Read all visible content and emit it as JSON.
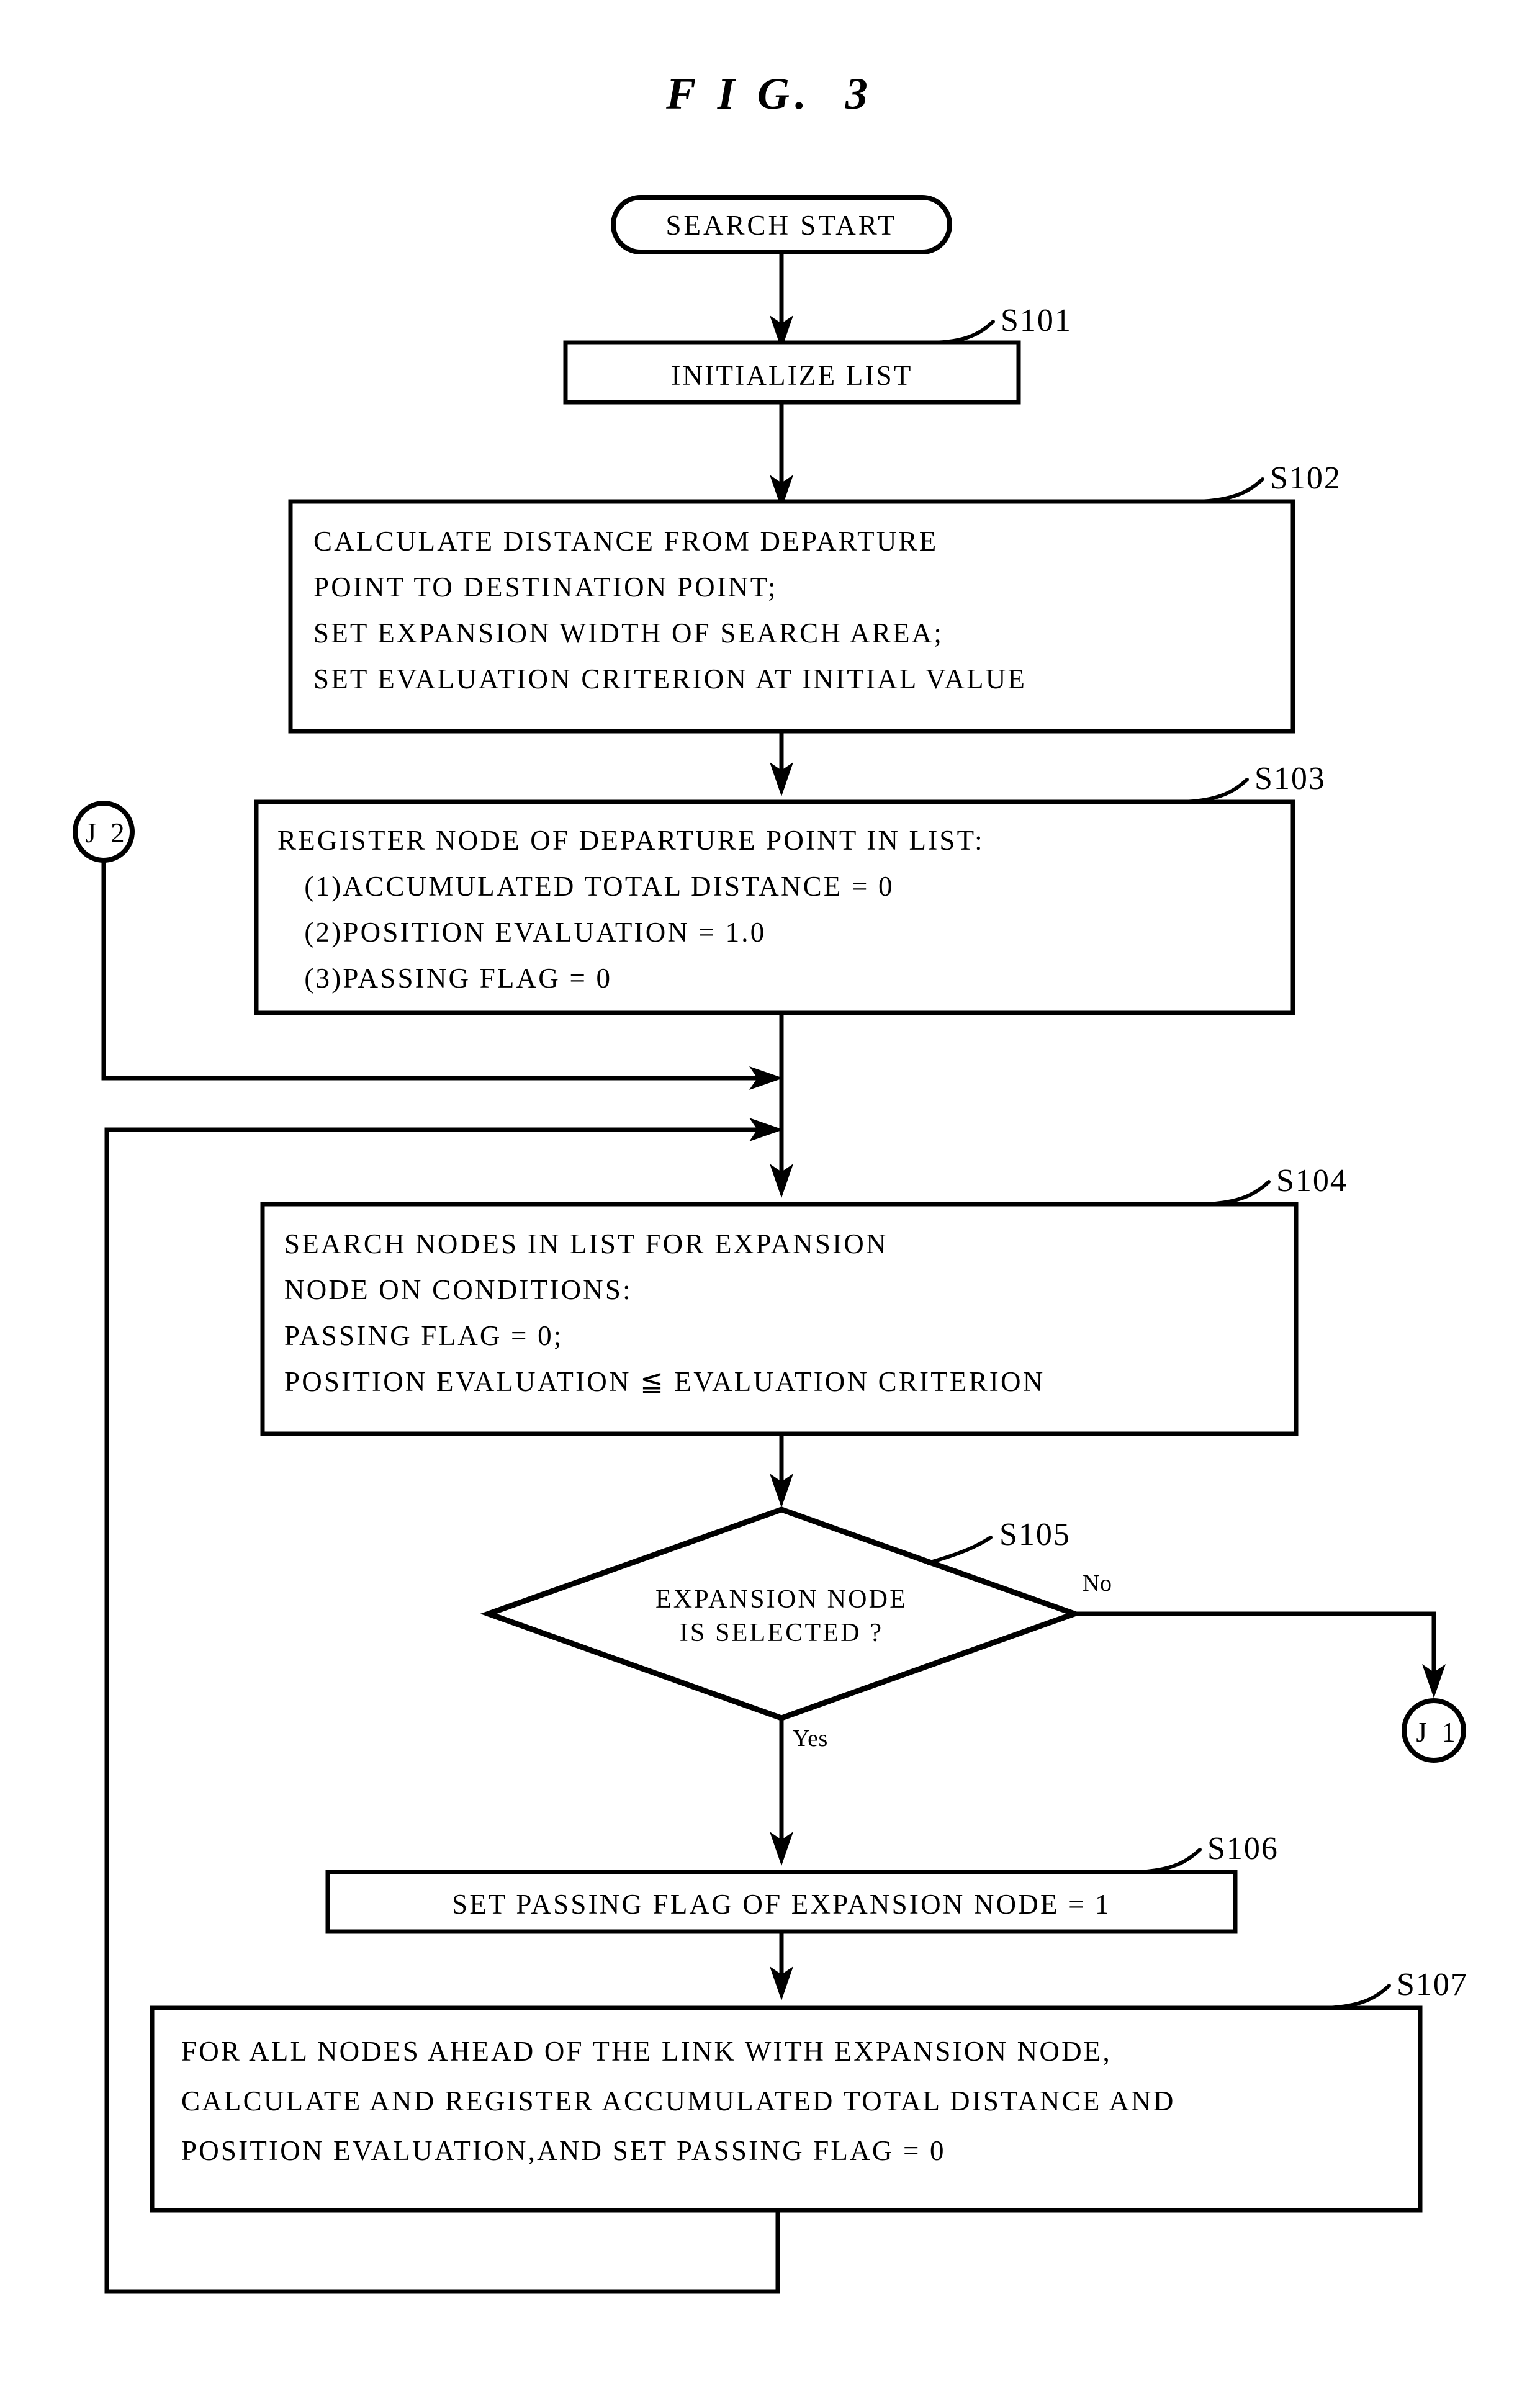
{
  "figure": {
    "title": "F I G.  3"
  },
  "nodes": {
    "start": {
      "label": "SEARCH START",
      "shape": "terminator"
    },
    "s101": {
      "step": "S101",
      "lines": [
        "INITIALIZE LIST"
      ],
      "shape": "process"
    },
    "s102": {
      "step": "S102",
      "lines": [
        "CALCULATE DISTANCE FROM DEPARTURE",
        "POINT TO DESTINATION POINT;",
        "SET EXPANSION WIDTH OF SEARCH AREA;",
        "SET EVALUATION CRITERION AT INITIAL VALUE"
      ],
      "shape": "process"
    },
    "s103": {
      "step": "S103",
      "lines": [
        "REGISTER NODE OF DEPARTURE POINT IN LIST:",
        "   (1)ACCUMULATED TOTAL DISTANCE = 0",
        "   (2)POSITION EVALUATION = 1.0",
        "   (3)PASSING FLAG = 0"
      ],
      "shape": "process"
    },
    "s104": {
      "step": "S104",
      "lines": [
        "SEARCH NODES IN LIST FOR EXPANSION",
        "NODE ON CONDITIONS:",
        "PASSING FLAG = 0;",
        "POSITION EVALUATION ≦ EVALUATION CRITERION"
      ],
      "shape": "process"
    },
    "s105": {
      "step": "S105",
      "lines": [
        "EXPANSION NODE",
        "IS SELECTED ?"
      ],
      "shape": "decision",
      "branch_yes": "Yes",
      "branch_no": "No"
    },
    "s106": {
      "step": "S106",
      "lines": [
        "SET PASSING FLAG OF EXPANSION NODE = 1"
      ],
      "shape": "process"
    },
    "s107": {
      "step": "S107",
      "lines": [
        "FOR ALL NODES AHEAD OF THE LINK WITH EXPANSION NODE,",
        "CALCULATE AND REGISTER ACCUMULATED TOTAL DISTANCE AND",
        "POSITION EVALUATION,AND SET PASSING FLAG = 0"
      ],
      "shape": "process"
    },
    "j1": {
      "label": "J 1",
      "shape": "connector"
    },
    "j2": {
      "label": "J 2",
      "shape": "connector"
    }
  },
  "colors": {
    "ink": "#000000",
    "paper": "#ffffff"
  }
}
